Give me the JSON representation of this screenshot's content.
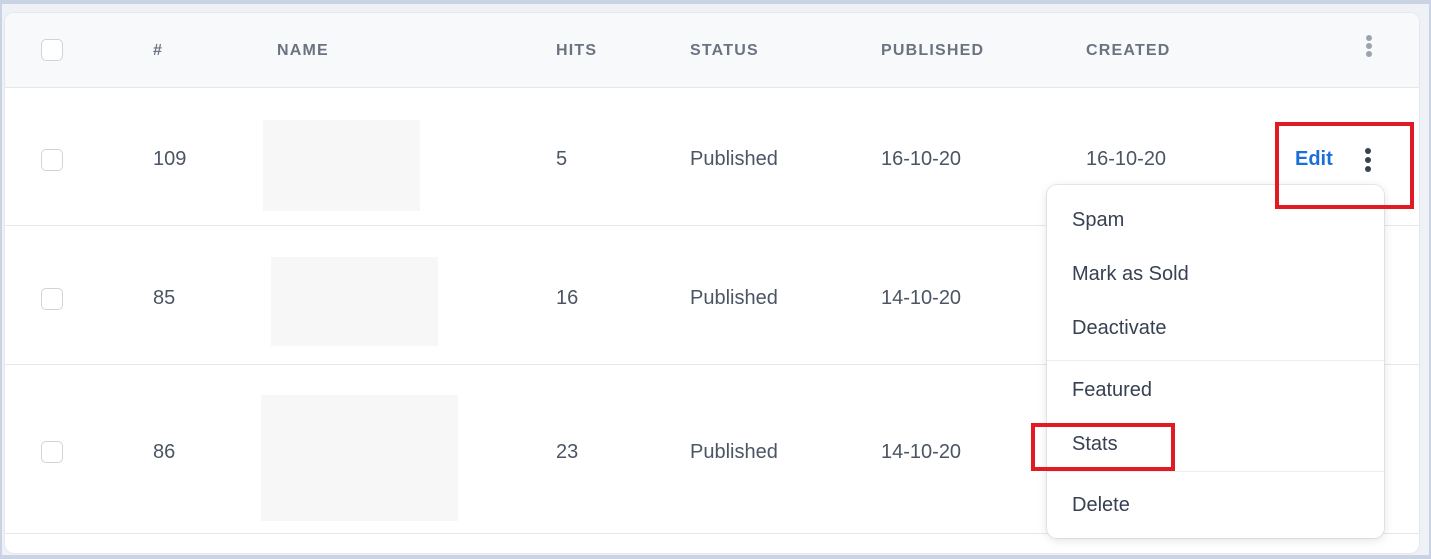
{
  "table": {
    "headers": {
      "num": "#",
      "name": "NAME",
      "hits": "HITS",
      "status": "STATUS",
      "published": "PUBLISHED",
      "created": "CREATED"
    },
    "rows": [
      {
        "id": "109",
        "hits": "5",
        "status": "Published",
        "published": "16-10-20",
        "created": "16-10-20"
      },
      {
        "id": "85",
        "hits": "16",
        "status": "Published",
        "published": "14-10-20"
      },
      {
        "id": "86",
        "hits": "23",
        "status": "Published",
        "published": "14-10-20"
      }
    ],
    "edit_label": "Edit"
  },
  "menu": {
    "items": [
      "Spam",
      "Mark as Sold",
      "Deactivate",
      "Featured",
      "Stats",
      "Delete"
    ]
  },
  "colors": {
    "accent": "#1d6fd8",
    "highlight": "#e01b24"
  }
}
